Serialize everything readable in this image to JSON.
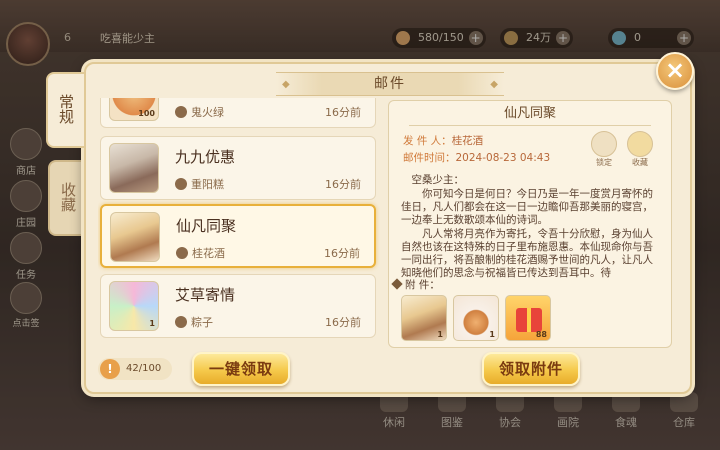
{
  "background": {
    "level": "6",
    "player_name": "吃喜能少主",
    "resources": [
      {
        "icon": "stamina-icon",
        "value": "580/150",
        "color": "#e8b070"
      },
      {
        "icon": "copper-coin-icon",
        "value": "24万",
        "color": "#c8a060"
      },
      {
        "icon": "jade-icon",
        "value": "0",
        "color": "#7ac0d8"
      }
    ],
    "side_buttons": [
      "商店",
      "庄园",
      "任务",
      "点击签"
    ],
    "bottom_nav": [
      "休闲",
      "图鉴",
      "协会",
      "画院",
      "食魂",
      "仓库"
    ]
  },
  "dialog": {
    "title": "邮件",
    "tabs": [
      {
        "label": "常规",
        "active": true
      },
      {
        "label": "收藏",
        "active": false
      }
    ],
    "mails": [
      {
        "title": "",
        "sender": "鬼火绿",
        "time": "16分前",
        "thumb": "food-icon",
        "count": "100",
        "selected": false
      },
      {
        "title": "九九优惠",
        "sender": "重阳糕",
        "time": "16分前",
        "thumb": "character-portrait",
        "count": "",
        "selected": false
      },
      {
        "title": "仙凡同聚",
        "sender": "桂花酒",
        "time": "16分前",
        "thumb": "character-portrait",
        "count": "",
        "selected": true
      },
      {
        "title": "艾草寄情",
        "sender": "粽子",
        "time": "16分前",
        "thumb": "rainbow-token-icon",
        "count": "1",
        "selected": false
      }
    ],
    "detail": {
      "title": "仙凡同聚",
      "sender_label": "发 件 人：",
      "sender": "桂花酒",
      "time_label": "邮件时间：",
      "time": "2024-08-23  04:43",
      "lock_label": "锁定",
      "collect_label": "收藏",
      "salutation": "空桑少主：",
      "paragraph1": "你可知今日是何日？今日乃是一年一度赏月寄怀的佳日，凡人们都会在这一日一边瞻仰吾那美丽的寝宫，一边奉上无数歌颂本仙的诗词。",
      "paragraph2": "凡人常将月亮作为寄托，令吾十分欣慰，身为仙人自然也该在这特殊的日子里布施恩惠。本仙现命你与吾一同出行，将吾酿制的桂花酒赐予世间的凡人，让凡人知晓他们的思念与祝福皆已传达到吾耳中。待",
      "attachments_label": "附      件：",
      "attachments": [
        {
          "icon": "character-card-icon",
          "count": "1"
        },
        {
          "icon": "mooncake-dish-icon",
          "count": "1"
        },
        {
          "icon": "gift-box-icon",
          "count": "88"
        }
      ]
    },
    "mail_count": "42/100",
    "claim_all_label": "一键领取",
    "claim_attachment_label": "领取附件"
  }
}
